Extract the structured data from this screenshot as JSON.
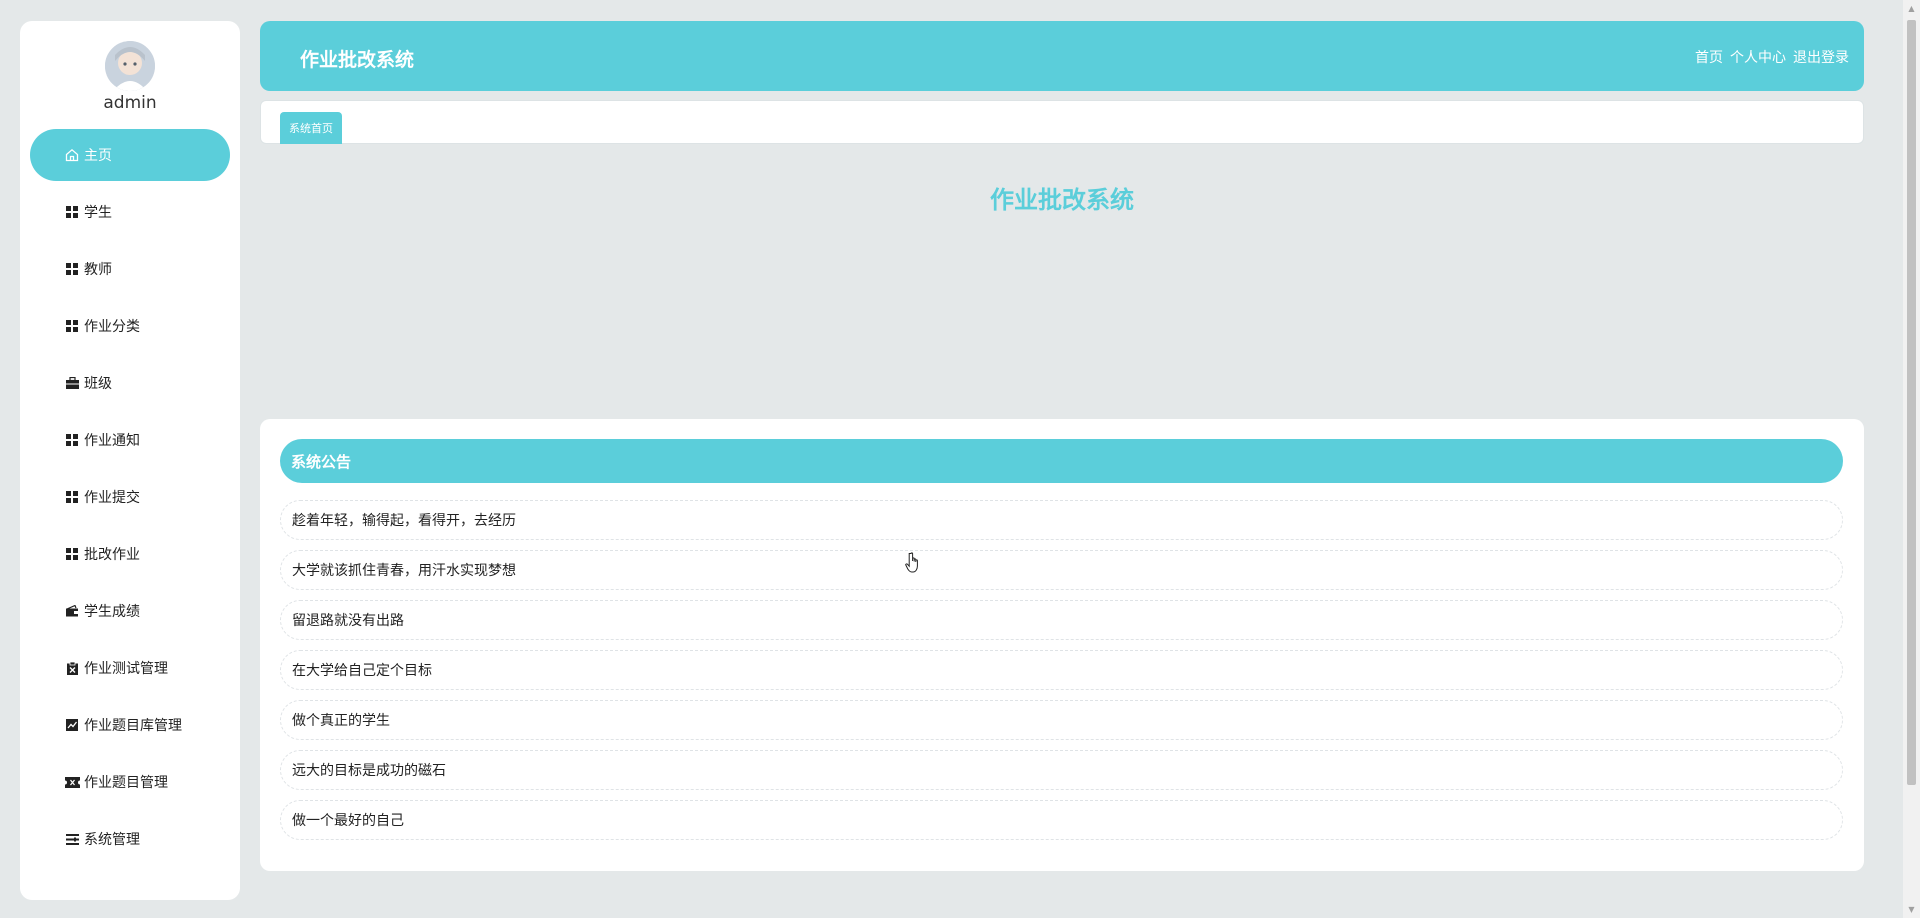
{
  "user": {
    "name": "admin"
  },
  "sidebar": {
    "items": [
      {
        "label": "主页",
        "icon": "home-icon",
        "active": true
      },
      {
        "label": "学生",
        "icon": "grid-icon"
      },
      {
        "label": "教师",
        "icon": "grid-icon"
      },
      {
        "label": "作业分类",
        "icon": "grid-icon"
      },
      {
        "label": "班级",
        "icon": "briefcase-icon"
      },
      {
        "label": "作业通知",
        "icon": "grid-icon"
      },
      {
        "label": "作业提交",
        "icon": "grid-icon"
      },
      {
        "label": "批改作业",
        "icon": "grid-icon"
      },
      {
        "label": "学生成绩",
        "icon": "wallet-icon"
      },
      {
        "label": "作业测试管理",
        "icon": "clipboard-x-icon"
      },
      {
        "label": "作业题目库管理",
        "icon": "chart-line-icon"
      },
      {
        "label": "作业题目管理",
        "icon": "ticket-icon"
      },
      {
        "label": "系统管理",
        "icon": "list-icon"
      }
    ]
  },
  "header": {
    "title": "作业批改系统",
    "nav": {
      "home": "首页",
      "profile": "个人中心",
      "logout": "退出登录"
    }
  },
  "tabs": [
    {
      "label": "系统首页"
    }
  ],
  "main": {
    "title": "作业批改系统"
  },
  "notices": {
    "title": "系统公告",
    "items": [
      "趁着年轻，输得起，看得开，去经历",
      "大学就该抓住青春，用汗水实现梦想",
      "留退路就没有出路",
      "在大学给自己定个目标",
      "做个真正的学生",
      "远大的目标是成功的磁石",
      "做一个最好的自己"
    ]
  },
  "colors": {
    "accent": "#5bceda",
    "background": "#e4e8e9"
  }
}
